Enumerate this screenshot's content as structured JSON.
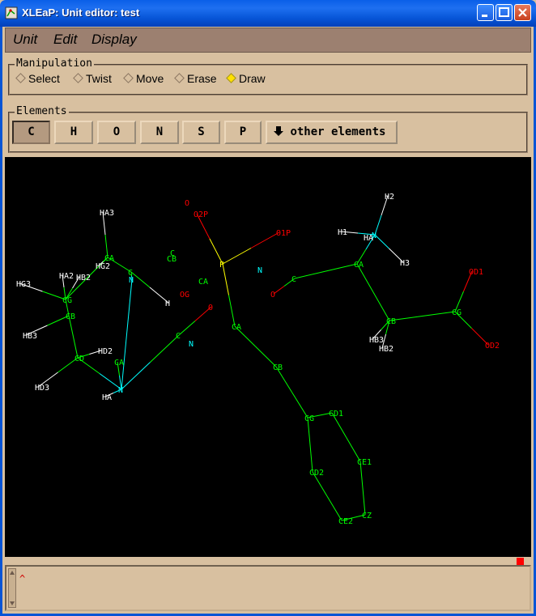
{
  "window": {
    "title": "XLEaP: Unit editor: test"
  },
  "menu": {
    "items": [
      "Unit",
      "Edit",
      "Display"
    ]
  },
  "manipulation": {
    "label": "Manipulation",
    "options": [
      "Select",
      "Twist",
      "Move",
      "Erase",
      "Draw"
    ],
    "selected": "Draw"
  },
  "elements": {
    "label": "Elements",
    "buttons": [
      "C",
      "H",
      "O",
      "N",
      "S",
      "P"
    ],
    "selected": "C",
    "other_label": "other elements"
  },
  "colors": {
    "carbon": "#00ff00",
    "hydrogen": "#ffffff",
    "oxygen": "#ff0000",
    "nitrogen": "#00ffff",
    "phosphorus": "#ffff00"
  },
  "molecule": {
    "atoms": [
      {
        "id": "HA3",
        "label": "HA3",
        "el": "H"
      },
      {
        "id": "CA1",
        "label": "CA",
        "el": "C"
      },
      {
        "id": "HG2",
        "label": "HG2",
        "el": "H"
      },
      {
        "id": "HA2",
        "label": "HA2",
        "el": "H"
      },
      {
        "id": "HB2L",
        "label": "HB2",
        "el": "H"
      },
      {
        "id": "C1",
        "label": "C",
        "el": "C"
      },
      {
        "id": "N1",
        "label": "N",
        "el": "N"
      },
      {
        "id": "H1",
        "label": "H",
        "el": "H"
      },
      {
        "id": "HG3",
        "label": "HG3",
        "el": "H"
      },
      {
        "id": "CG1",
        "label": "CG",
        "el": "C"
      },
      {
        "id": "CB1",
        "label": "CB",
        "el": "C"
      },
      {
        "id": "HB3L",
        "label": "HB3",
        "el": "H"
      },
      {
        "id": "HD2",
        "label": "HD2",
        "el": "H"
      },
      {
        "id": "CD1",
        "label": "CD",
        "el": "C"
      },
      {
        "id": "CAL",
        "label": "CA",
        "el": "C"
      },
      {
        "id": "HD3",
        "label": "HD3",
        "el": "H"
      },
      {
        "id": "HA",
        "label": "HA",
        "el": "H"
      },
      {
        "id": "N2",
        "label": "N",
        "el": "N"
      },
      {
        "id": "C2",
        "label": "C",
        "el": "C"
      },
      {
        "id": "O1",
        "label": "O",
        "el": "O"
      },
      {
        "id": "N3",
        "label": "N",
        "el": "N"
      },
      {
        "id": "OTOP",
        "label": "O",
        "el": "O"
      },
      {
        "id": "O2P",
        "label": "O2P",
        "el": "O"
      },
      {
        "id": "C3",
        "label": "C",
        "el": "C"
      },
      {
        "id": "CB2",
        "label": "CB",
        "el": "C"
      },
      {
        "id": "OG",
        "label": "OG",
        "el": "O"
      },
      {
        "id": "CA2",
        "label": "CA",
        "el": "C"
      },
      {
        "id": "P",
        "label": "P",
        "el": "P"
      },
      {
        "id": "O1P",
        "label": "O1P",
        "el": "O"
      },
      {
        "id": "N4",
        "label": "N",
        "el": "N"
      },
      {
        "id": "CAM",
        "label": "CA",
        "el": "C"
      },
      {
        "id": "CBM",
        "label": "CB",
        "el": "C"
      },
      {
        "id": "CGM",
        "label": "CG",
        "el": "C"
      },
      {
        "id": "CD1M",
        "label": "CD1",
        "el": "C"
      },
      {
        "id": "CD2M",
        "label": "CD2",
        "el": "C"
      },
      {
        "id": "CE1M",
        "label": "CE1",
        "el": "C"
      },
      {
        "id": "CE2M",
        "label": "CE2",
        "el": "C"
      },
      {
        "id": "CZM",
        "label": "CZ",
        "el": "C"
      },
      {
        "id": "O2",
        "label": "O",
        "el": "O"
      },
      {
        "id": "C4",
        "label": "C",
        "el": "C"
      },
      {
        "id": "CAR",
        "label": "CA",
        "el": "C"
      },
      {
        "id": "H2",
        "label": "H2",
        "el": "H"
      },
      {
        "id": "H1R",
        "label": "H1",
        "el": "H"
      },
      {
        "id": "HAR",
        "label": "HA",
        "el": "H"
      },
      {
        "id": "NR",
        "label": "N",
        "el": "N"
      },
      {
        "id": "H3",
        "label": "H3",
        "el": "H"
      },
      {
        "id": "OD1",
        "label": "OD1",
        "el": "O"
      },
      {
        "id": "CGR",
        "label": "CG",
        "el": "C"
      },
      {
        "id": "CBR",
        "label": "CB",
        "el": "C"
      },
      {
        "id": "HB3R",
        "label": "HB3",
        "el": "H"
      },
      {
        "id": "HB2R",
        "label": "HB2",
        "el": "H"
      },
      {
        "id": "OD2",
        "label": "OD2",
        "el": "O"
      }
    ]
  }
}
